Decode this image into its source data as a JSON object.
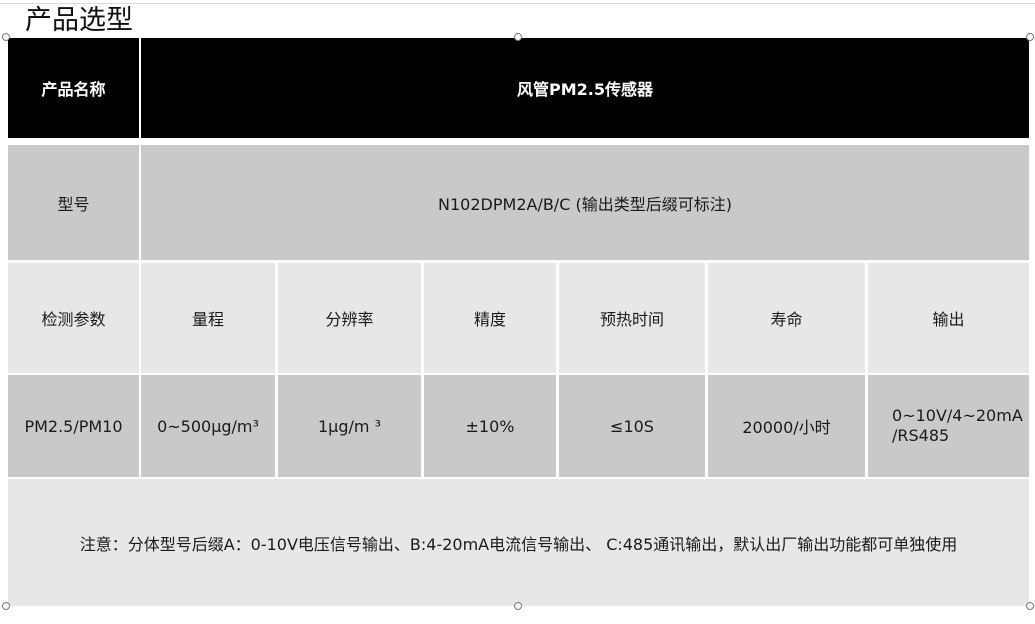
{
  "page_title": "产品选型",
  "table": {
    "header": {
      "label": "产品名称",
      "value": "风管PM2.5传感器"
    },
    "model": {
      "label": "型号",
      "value": "N102DPM2A/B/C (输出类型后缀可标注)"
    },
    "spec_headers": [
      "检测参数",
      "量程",
      "分辨率",
      "精度",
      "预热时间",
      "寿命",
      "输出"
    ],
    "spec_values": [
      "PM2.5/PM10",
      "0~500μg/m³",
      "1μg/m ³",
      "±10%",
      "≤10S",
      "20000/小时",
      "0~10V/4~20mA\n/RS485"
    ],
    "note": "注意：分体型号后缀A：0-10V电压信号输出、B:4-20mA电流信号输出、 C:485通讯输出，默认出厂输出功能都可单独使用"
  }
}
